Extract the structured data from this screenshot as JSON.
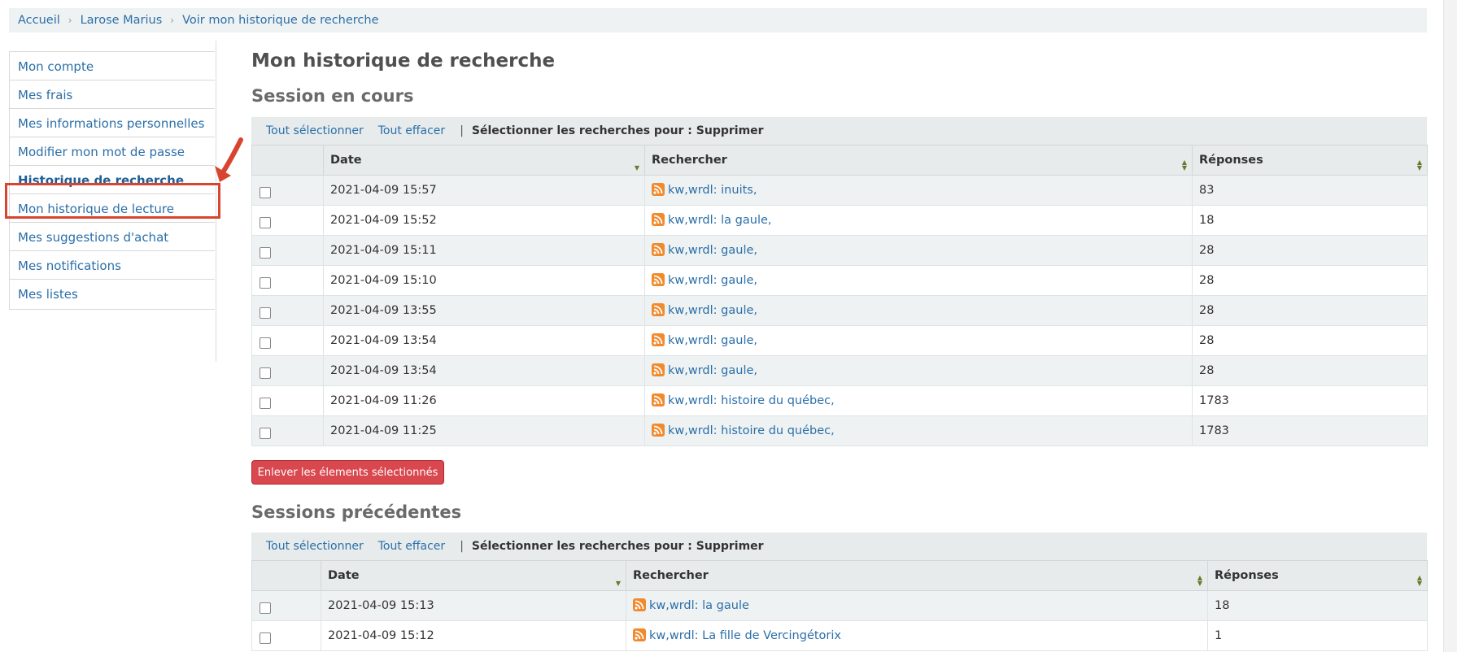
{
  "breadcrumb": [
    "Accueil",
    "Larose Marius",
    "Voir mon historique de recherche"
  ],
  "sidebar": {
    "items": [
      {
        "label": "Mon compte"
      },
      {
        "label": "Mes frais"
      },
      {
        "label": "Mes informations personnelles"
      },
      {
        "label": "Modifier mon mot de passe"
      },
      {
        "label": "Historique de recherche",
        "active": true
      },
      {
        "label": "Mon historique de lecture"
      },
      {
        "label": "Mes suggestions d'achat"
      },
      {
        "label": "Mes notifications"
      },
      {
        "label": "Mes listes"
      }
    ]
  },
  "page_title": "Mon historique de recherche",
  "current_session": {
    "heading": "Session en cours",
    "toolbar": {
      "select_all": "Tout sélectionner",
      "clear_all": "Tout effacer",
      "action_label": "Sélectionner les recherches pour :",
      "action": "Supprimer"
    },
    "columns": [
      "Date",
      "Rechercher",
      "Réponses"
    ],
    "rows": [
      {
        "date": "2021-04-09 15:57",
        "search": "kw,wrdl: inuits,",
        "results": "83"
      },
      {
        "date": "2021-04-09 15:52",
        "search": "kw,wrdl: la gaule,",
        "results": "18"
      },
      {
        "date": "2021-04-09 15:11",
        "search": "kw,wrdl: gaule,",
        "results": "28"
      },
      {
        "date": "2021-04-09 15:10",
        "search": "kw,wrdl: gaule,",
        "results": "28"
      },
      {
        "date": "2021-04-09 13:55",
        "search": "kw,wrdl: gaule,",
        "results": "28"
      },
      {
        "date": "2021-04-09 13:54",
        "search": "kw,wrdl: gaule,",
        "results": "28"
      },
      {
        "date": "2021-04-09 13:54",
        "search": "kw,wrdl: gaule,",
        "results": "28"
      },
      {
        "date": "2021-04-09 11:26",
        "search": "kw,wrdl: histoire du québec,",
        "results": "1783"
      },
      {
        "date": "2021-04-09 11:25",
        "search": "kw,wrdl: histoire du québec,",
        "results": "1783"
      }
    ],
    "remove_button": "Enlever les élements sélectionnés"
  },
  "previous_sessions": {
    "heading": "Sessions précédentes",
    "toolbar": {
      "select_all": "Tout sélectionner",
      "clear_all": "Tout effacer",
      "action_label": "Sélectionner les recherches pour :",
      "action": "Supprimer"
    },
    "columns": [
      "Date",
      "Rechercher",
      "Réponses"
    ],
    "rows": [
      {
        "date": "2021-04-09 15:13",
        "search": "kw,wrdl: la gaule",
        "results": "18"
      },
      {
        "date": "2021-04-09 15:12",
        "search": "kw,wrdl: La fille de Vercingétorix",
        "results": "1"
      }
    ]
  },
  "colors": {
    "link": "#2b6fa8",
    "remove_button": "#d9474f",
    "highlight": "#d9442f",
    "rss": "#f18a2d"
  }
}
